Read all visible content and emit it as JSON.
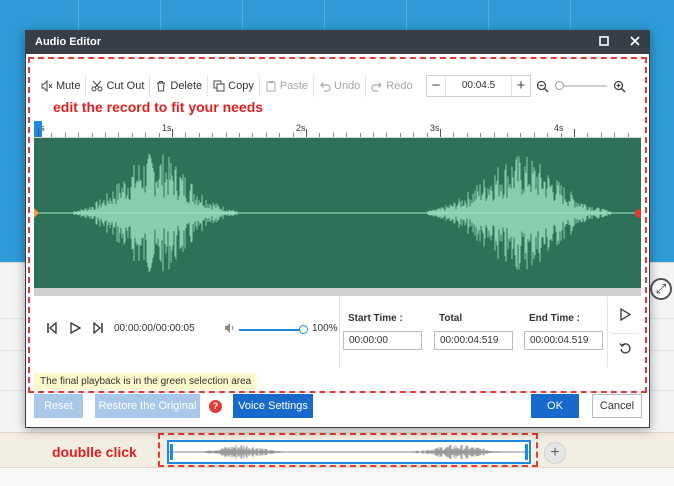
{
  "dialog": {
    "title": "Audio Editor",
    "maximize_icon": "maximize-icon",
    "close_icon": "close-icon"
  },
  "toolbar": {
    "mute": "Mute",
    "cut_out": "Cut Out",
    "delete": "Delete",
    "copy": "Copy",
    "paste": "Paste",
    "undo": "Undo",
    "redo": "Redo",
    "time_value": "00:04.5",
    "minus": "−",
    "plus": "+"
  },
  "annotations": {
    "edit_hint": "edit the record to fit your needs",
    "double_click_hint": "doublle click"
  },
  "ruler": {
    "labels": [
      "s",
      "1s",
      "2s",
      "3s",
      "4s"
    ]
  },
  "transport": {
    "time_display": "00:00:00/00:00:05",
    "volume": "100%",
    "volume_level": 1.0
  },
  "time_fields": {
    "start_label": "Start Time :",
    "start_value": "00:00:00",
    "total_label": "Total",
    "total_value": "00:00:04.519",
    "end_label": "End Time :",
    "end_value": "00:00:04.519"
  },
  "hint": "The final playback is in the green selection area",
  "buttons": {
    "reset": "Reset",
    "restore": "Restore the Original",
    "help": "?",
    "voice_settings": "Voice Settings",
    "ok": "OK",
    "cancel": "Cancel"
  },
  "colors": {
    "waveform_bg": "#2e7158",
    "waveform": "#9fe6c3",
    "accent": "#1769cc",
    "annotation": "#e02020"
  }
}
